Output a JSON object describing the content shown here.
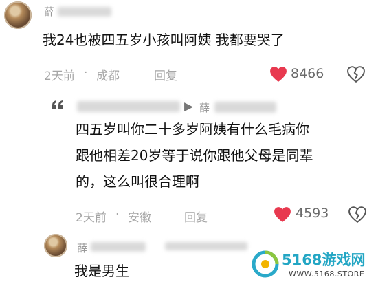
{
  "comments": [
    {
      "username": "薛",
      "text": "我24也被四五岁小孩叫阿姨 我都要哭了",
      "time": "2天前",
      "location": "成都",
      "reply_label": "回复",
      "likes": "8466"
    },
    {
      "username": "薛",
      "text_lines": [
        "四五岁叫你二十多岁阿姨有什么毛病你",
        "跟他相差20岁等于说你跟他父母是同辈",
        "的，这么叫很合理啊"
      ],
      "time": "2天前",
      "location": "安徽",
      "reply_label": "回复",
      "likes": "4593"
    },
    {
      "username": "薛",
      "text": "我是男生"
    }
  ],
  "separator": "·",
  "watermark": {
    "brand": "5168游戏网",
    "url": "WWW.5168.STORE"
  },
  "icons": {
    "like": "heart-icon",
    "dislike": "broken-heart-icon",
    "reply_arrow": "reply-arrow-icon",
    "quote": "quote-icon"
  },
  "colors": {
    "heart": "#e8394f",
    "meta": "#a5a5a5"
  }
}
